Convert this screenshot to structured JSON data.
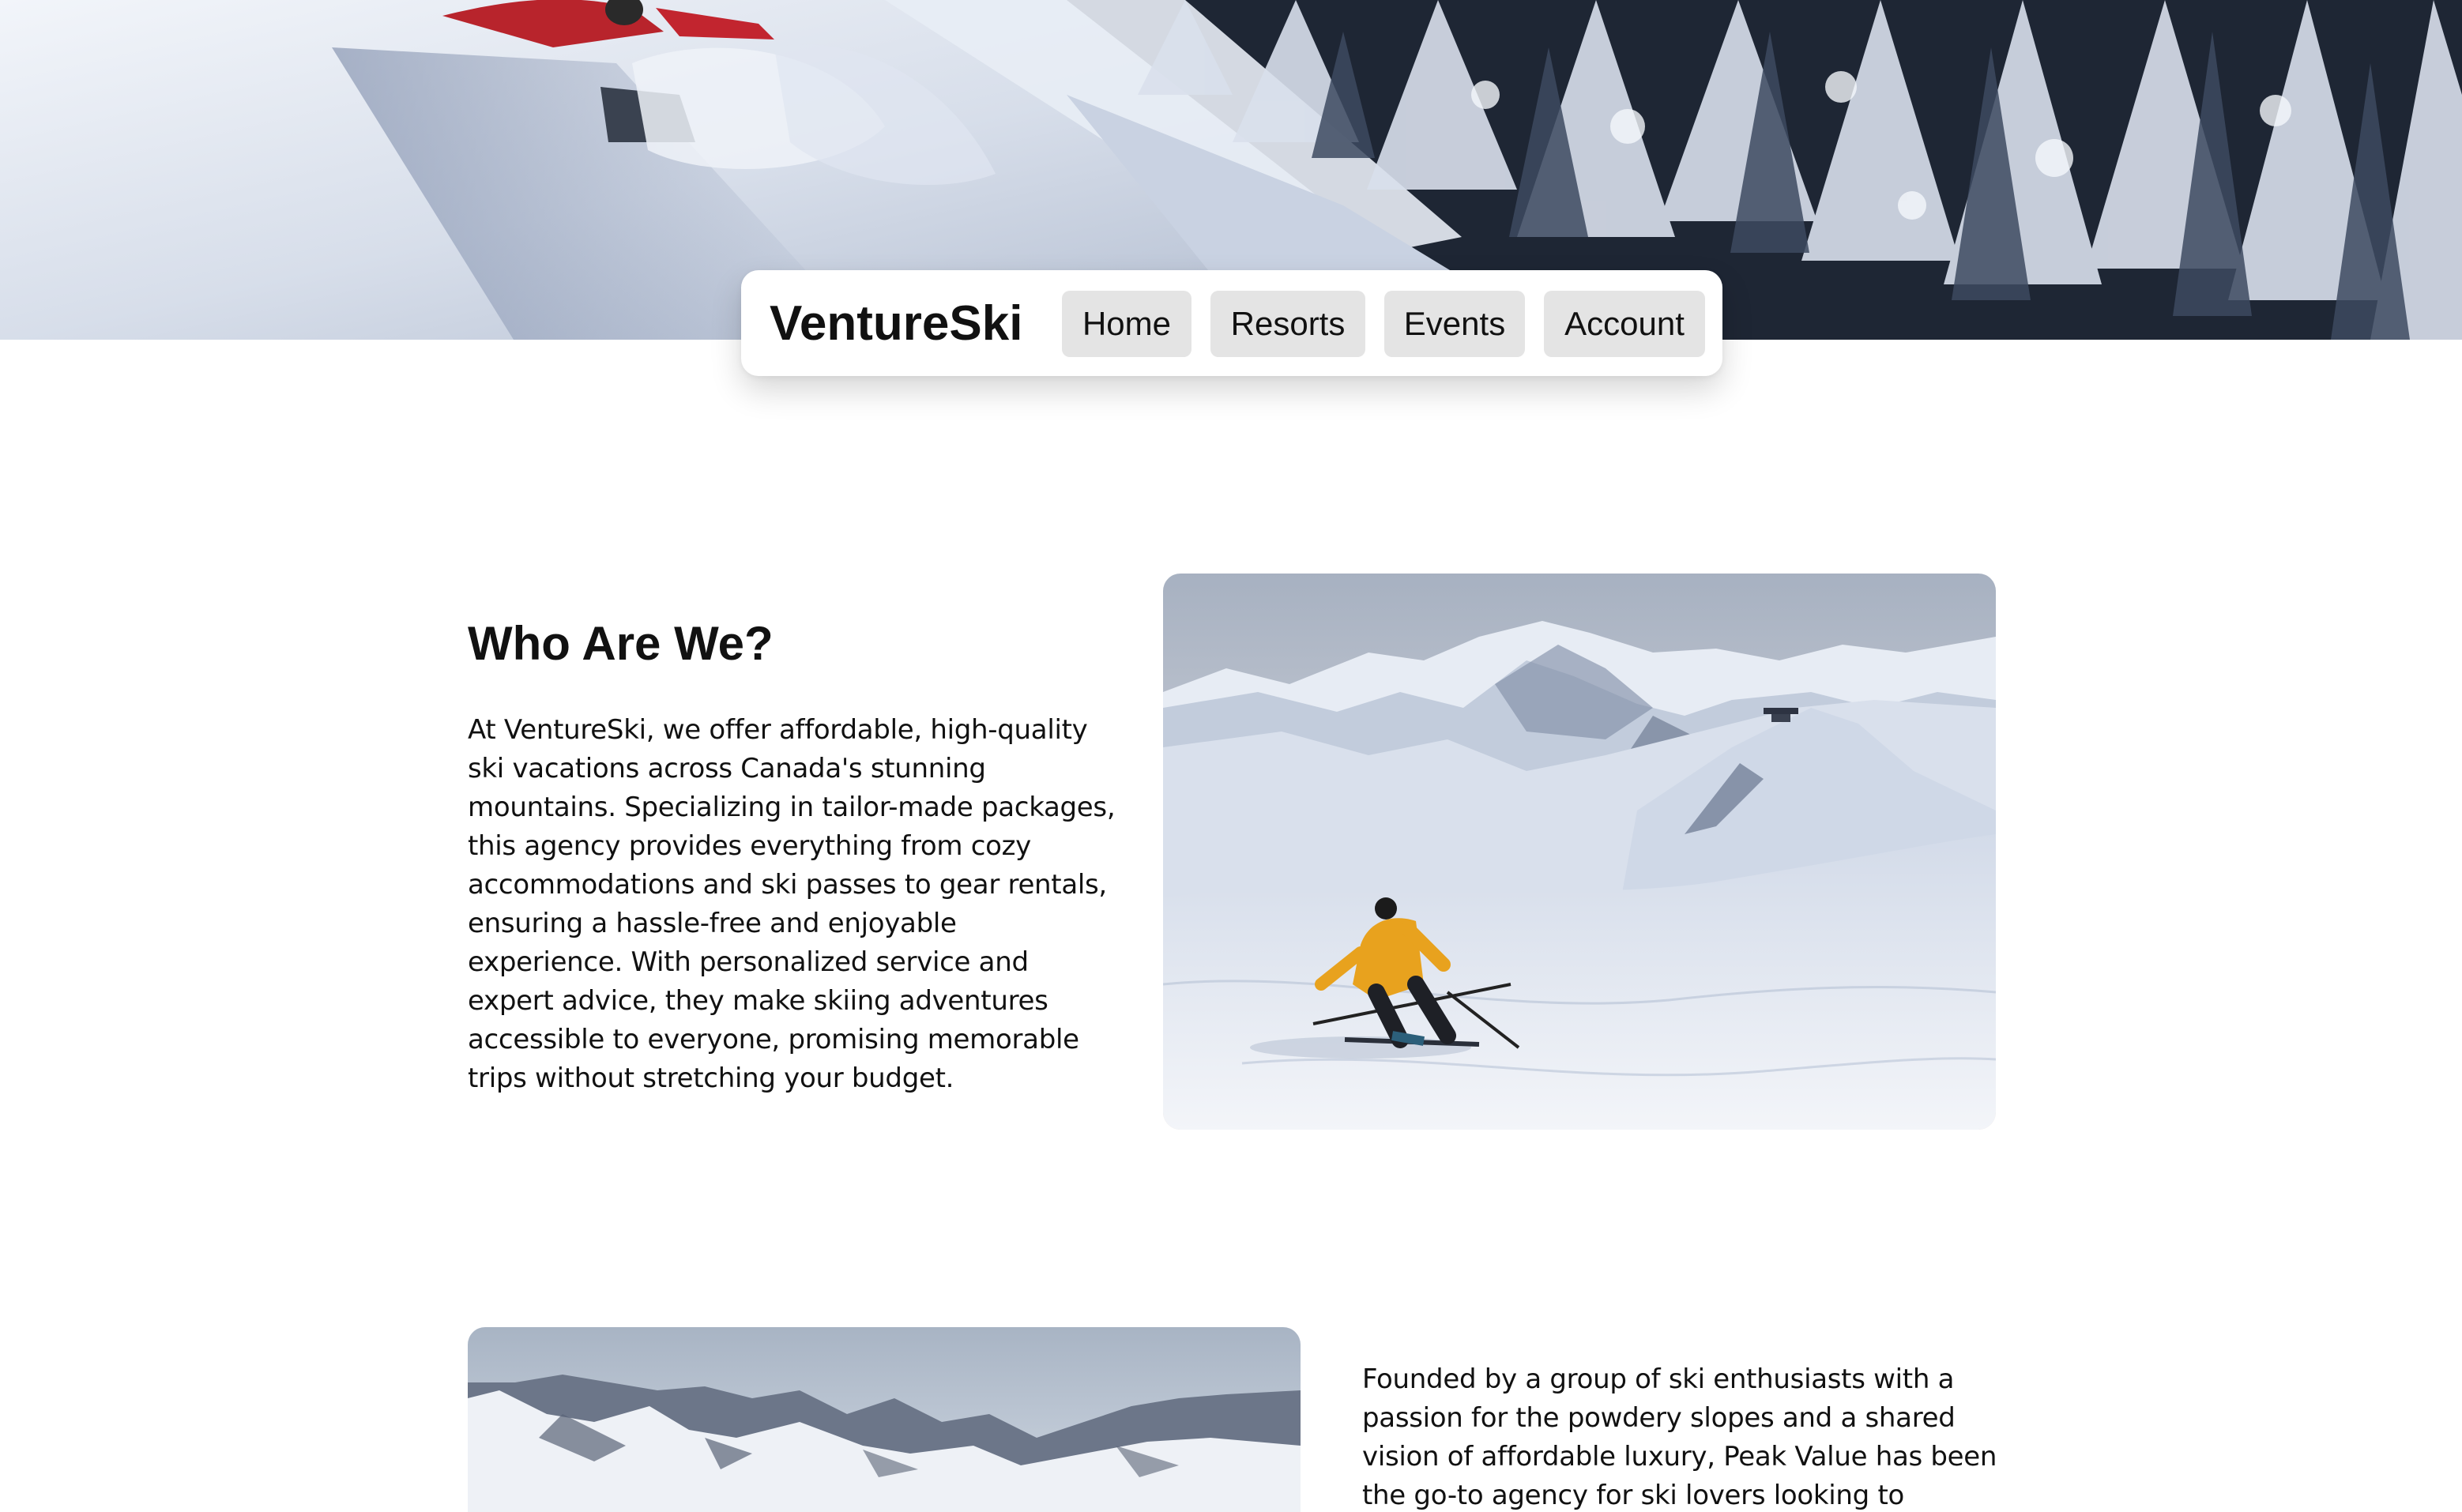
{
  "hero": {
    "image": "skier-powder-forest-banner"
  },
  "nav": {
    "brand": "VentureSki",
    "items": [
      {
        "label": "Home"
      },
      {
        "label": "Resorts"
      },
      {
        "label": "Events"
      },
      {
        "label": "Account"
      }
    ]
  },
  "about": {
    "title": "Who Are We?",
    "body": "At VentureSki, we offer affordable, high-quality ski vacations across Canada's stunning mountains. Specializing in tailor-made packages, this agency provides everything from cozy accommodations and ski passes to gear rentals, ensuring a hassle-free and enjoyable experience. With personalized service and expert advice, they make skiing adventures accessible to everyone, promising memorable trips without stretching your budget.",
    "image": "skier-on-slope-photo"
  },
  "history": {
    "body": "Founded by a group of ski enthusiasts with a passion for the powdery slopes and a shared vision of affordable luxury, Peak Value has been the go-to agency for ski lovers looking to explore",
    "image": "mountain-range-photo"
  }
}
